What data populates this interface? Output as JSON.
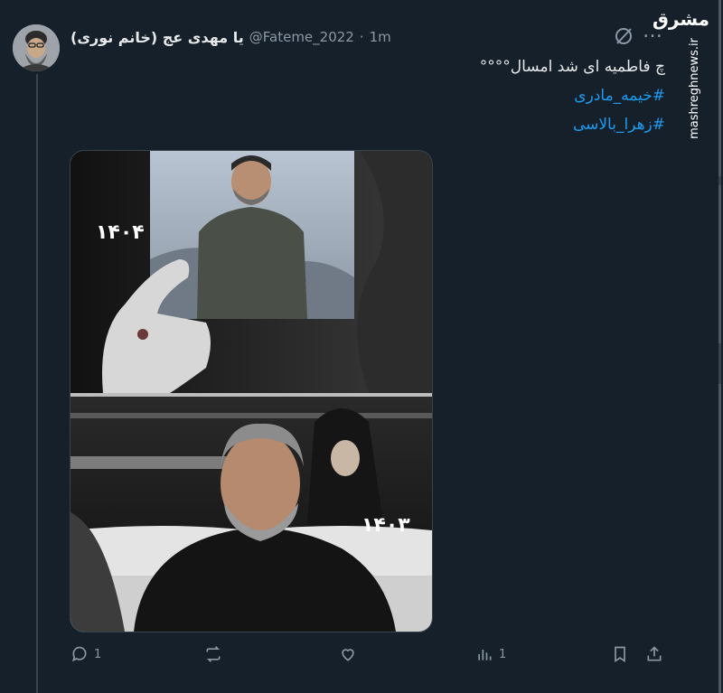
{
  "author": {
    "display_name": "یا مهدی عج (خانم نوری)",
    "handle": "@Fateme_2022",
    "separator": "·",
    "time": "1m"
  },
  "tweet": {
    "text": "چ فاطمیه ای شد امسال°°°°",
    "hashtags": [
      "#خیمه_مادری",
      "#زهرا_بالاسی"
    ]
  },
  "media": {
    "top_year": "۱۴۰۴",
    "bottom_year": "۱۴۰۳"
  },
  "actions": {
    "reply_count": "1",
    "retweet_count": "",
    "like_count": "",
    "views_count": "1"
  },
  "watermark": {
    "logo": "مشرق",
    "site": "mashreghnews.ir"
  },
  "icons": {
    "avatar": "user-avatar",
    "grok": "grok-icon",
    "more": "more-dots-icon",
    "reply": "reply-icon",
    "retweet": "retweet-icon",
    "like": "heart-icon",
    "views": "views-bar-icon",
    "bookmark": "bookmark-icon",
    "share": "share-icon"
  },
  "colors": {
    "background": "#15202b",
    "text": "#e7e9ea",
    "secondary": "#8b98a5",
    "link": "#1d9bf0",
    "border": "#38444d"
  }
}
